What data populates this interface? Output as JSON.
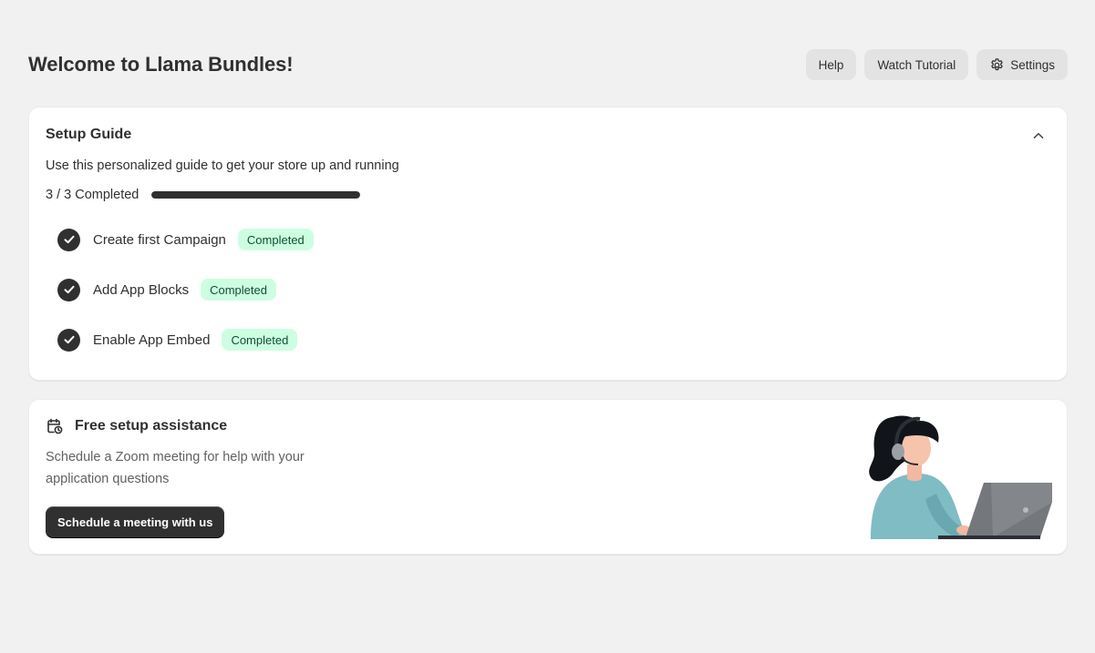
{
  "header": {
    "title": "Welcome to Llama Bundles!",
    "help_label": "Help",
    "tutorial_label": "Watch Tutorial",
    "settings_label": "Settings"
  },
  "setup_guide": {
    "title": "Setup Guide",
    "description": "Use this personalized guide to get your store up and running",
    "progress_text": "3 / 3 Completed",
    "progress_fraction": 1.0,
    "steps": [
      {
        "label": "Create first Campaign",
        "status": "Completed"
      },
      {
        "label": "Add App Blocks",
        "status": "Completed"
      },
      {
        "label": "Enable App Embed",
        "status": "Completed"
      }
    ]
  },
  "assistance": {
    "title": "Free setup assistance",
    "description": "Schedule a Zoom meeting for help with your application questions",
    "cta_label": "Schedule a meeting with us",
    "icon": "calendar-clock-icon",
    "illustration": "support-agent-illustration"
  },
  "colors": {
    "background": "#f1f1f1",
    "text": "#303030",
    "badge_bg": "#cdfee1",
    "badge_text": "#0c5132",
    "primary_button": "#303030"
  }
}
